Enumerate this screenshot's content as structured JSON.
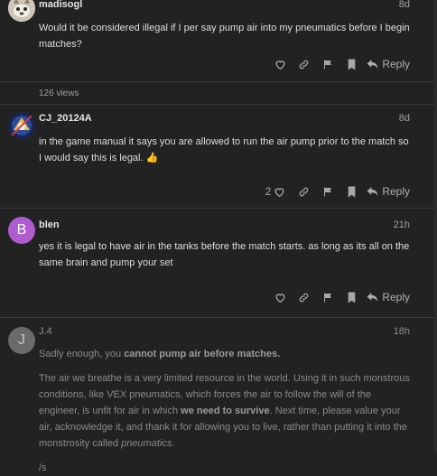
{
  "posts": [
    {
      "username": "madisogl",
      "date": "8d",
      "text": "Would it be considered illegal if I per say pump air into my pneumatics before I begin matches?",
      "reply_label": "Reply",
      "views": "126 views"
    },
    {
      "username": "CJ_20124A",
      "date": "8d",
      "text": "in the game manual it says you are allowed to run the air pump prior to the match so I would say this is legal. 👍",
      "like_count": "2",
      "reply_label": "Reply"
    },
    {
      "username": "blen",
      "date": "21h",
      "avatar_letter": "B",
      "avatar_color": "#b05cd0",
      "text": "yes it is legal to have air in the tanks before the match starts. as long as its all on the same brain and pump your set",
      "reply_label": "Reply"
    },
    {
      "username": "J.4",
      "date": "18h",
      "avatar_letter": "J",
      "avatar_color": "#6a6a6a",
      "p1_start": "Sadly enough, you ",
      "p1_bold": "cannot pump air before matches.",
      "p2_part1": "The air we breathe is a very limited resource in the world. Using it in such monstrous conditions, like VEX pneumatics, which forces the air to follow the will of the engineer, is unfit for air in which ",
      "p2_bold": "we need to survive",
      "p2_part2": ". Next time, please value your air, acknowledge it, and thank it for allowing you to live, rather than putting it into the monstrosity called ",
      "p2_italic": "pneumatics",
      "p2_end": ".",
      "p3": "/s"
    }
  ]
}
